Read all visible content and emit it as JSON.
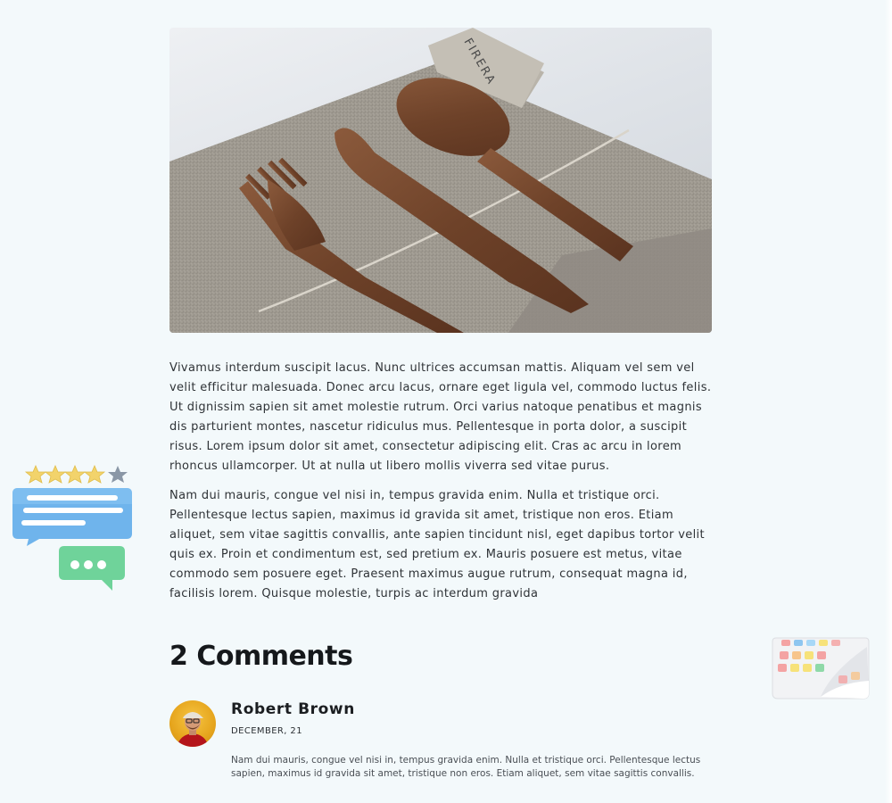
{
  "hero": {
    "image": "wooden-cutlery-on-linen",
    "tag_text": "FIRERA"
  },
  "article": {
    "paragraphs": [
      "Vivamus interdum suscipit lacus. Nunc ultrices accumsan mattis. Aliquam vel sem vel velit efficitur malesuada. Donec arcu lacus, ornare eget ligula vel, commodo luctus felis. Ut dignissim sapien sit amet molestie rutrum. Orci varius natoque penatibus et magnis dis parturient montes, nascetur ridiculus mus. Pellentesque in porta dolor, a suscipit risus. Lorem ipsum dolor sit amet, consectetur adipiscing elit. Cras ac arcu in lorem rhoncus ullamcorper. Ut at nulla ut libero mollis viverra sed vitae purus.",
      "Nam dui mauris, congue vel nisi in, tempus gravida enim. Nulla et tristique orci. Pellentesque lectus sapien, maximus id gravida sit amet, tristique non eros. Etiam aliquet, sem vitae sagittis convallis, ante sapien tincidunt nisl, eget dapibus tortor velit quis ex. Proin et condimentum est, sed pretium ex. Mauris posuere est metus, vitae commodo sem posuere eget. Praesent maximus augue rutrum, consequat magna id, facilisis lorem. Quisque molestie, turpis ac interdum gravida"
    ]
  },
  "comments": {
    "title": "2 Comments",
    "items": [
      {
        "author": "Robert Brown",
        "date": "DECEMBER, 21",
        "body": "Nam dui mauris, congue vel nisi in, tempus gravida enim. Nulla et tristique orci. Pellentesque lectus sapien, maximus id gravida sit amet, tristique non eros. Etiam aliquet, sem vitae sagittis convallis."
      }
    ]
  },
  "decorations": {
    "left": "review-chat-bubbles-icon",
    "left_stars_filled": 4,
    "left_stars_total": 5,
    "right": "calendar-icon"
  },
  "colors": {
    "background": "#f3f9fb",
    "text": "#2f3337",
    "heading": "#15181b",
    "star": "#f2d36b",
    "bubble_blue": "#6fb4ec",
    "bubble_green": "#6fd39a"
  }
}
